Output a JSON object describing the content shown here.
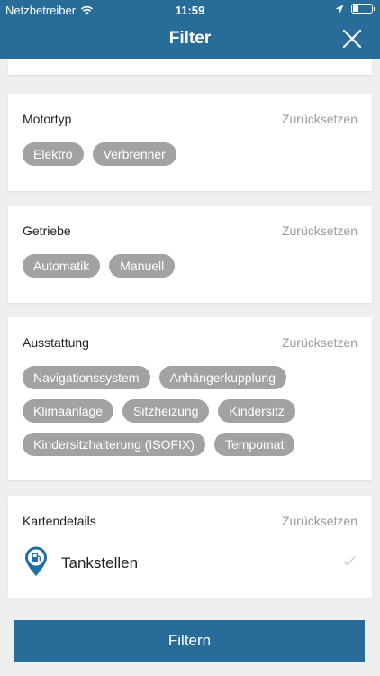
{
  "status_bar": {
    "carrier": "Netzbetreiber",
    "time": "11:59"
  },
  "nav": {
    "title": "Filter",
    "close_icon": "close-icon"
  },
  "colors": {
    "accent": "#286c9a",
    "chip": "#a2a2a2",
    "background": "#efefef"
  },
  "sections": {
    "motortyp": {
      "title": "Motortyp",
      "reset": "Zurücksetzen",
      "chips": [
        "Elektro",
        "Verbrenner"
      ]
    },
    "getriebe": {
      "title": "Getriebe",
      "reset": "Zurücksetzen",
      "chips": [
        "Automatik",
        "Manuell"
      ]
    },
    "ausstattung": {
      "title": "Ausstattung",
      "reset": "Zurücksetzen",
      "chips": [
        "Navigationssystem",
        "Anhängerkupplung",
        "Klimaanlage",
        "Sitzheizung",
        "Kindersitz",
        "Kindersitzhalterung (ISOFIX)",
        "Tempomat"
      ]
    },
    "kartendetails": {
      "title": "Kartendetails",
      "reset": "Zurücksetzen",
      "item": {
        "label": "Tankstellen",
        "icon": "fuel-station-pin-icon",
        "checked": true
      }
    }
  },
  "footer": {
    "button": "Filtern"
  }
}
